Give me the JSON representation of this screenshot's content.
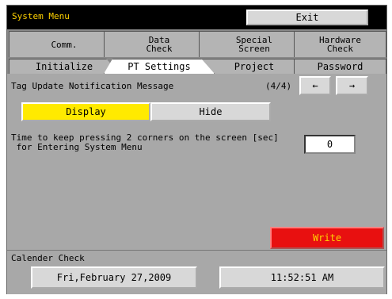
{
  "window": {
    "title": "System Menu",
    "exit_label": "Exit"
  },
  "tabs_row1": [
    "Comm.",
    "Data\nCheck",
    "Special\nScreen",
    "Hardware\nCheck"
  ],
  "tabs_row2": [
    "Initialize",
    "PT Settings",
    "Project",
    "Password"
  ],
  "active_tab": "PT Settings",
  "tag_update": {
    "label": "Tag Update Notification Message",
    "page_indicator": "(4/4)",
    "prev_label": "←",
    "next_label": "→",
    "display_label": "Display",
    "hide_label": "Hide",
    "selected": "Display"
  },
  "corner_press": {
    "label_line1": "Time to keep pressing 2 corners on the screen  [sec]",
    "label_line2": " for Entering System Menu",
    "value": "0"
  },
  "write_label": "Write",
  "calendar": {
    "label": "Calender Check",
    "date": "Fri,February 27,2009",
    "time": "11:52:51 AM"
  },
  "colors": {
    "accent_yellow": "#ffea00",
    "write_red": "#e81010",
    "title_text": "#ffd200"
  }
}
